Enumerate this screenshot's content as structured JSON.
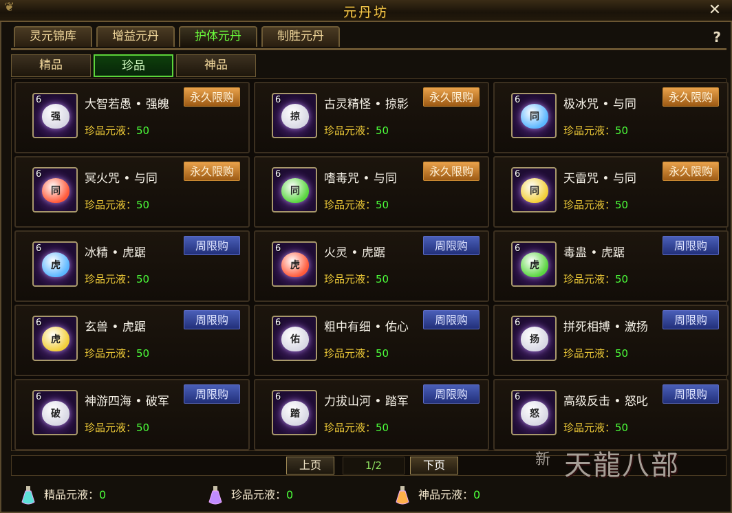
{
  "window": {
    "title": "元丹坊",
    "close": "✕",
    "help": "?"
  },
  "tabs": [
    "灵元锦库",
    "增益元丹",
    "护体元丹",
    "制胜元丹"
  ],
  "active_tab": 2,
  "subtabs": [
    "精品",
    "珍品",
    "神品"
  ],
  "active_subtab": 1,
  "price_label": "珍品元液：",
  "items": [
    {
      "name": "大智若愚 • 强魄",
      "level": "6",
      "glyph": "强",
      "badge": "永久限购",
      "badge_type": "perm",
      "price": "50",
      "color": "#d8d8e4"
    },
    {
      "name": "古灵精怪 • 掠影",
      "level": "6",
      "glyph": "掠",
      "badge": "永久限购",
      "badge_type": "perm",
      "price": "50",
      "color": "#d8d8e4"
    },
    {
      "name": "极冰咒 • 与同",
      "level": "6",
      "glyph": "同",
      "badge": "永久限购",
      "badge_type": "perm",
      "price": "50",
      "color": "#5ab6ff"
    },
    {
      "name": "冥火咒 • 与同",
      "level": "6",
      "glyph": "同",
      "badge": "永久限购",
      "badge_type": "perm",
      "price": "50",
      "color": "#ff5a3a"
    },
    {
      "name": "嗜毒咒 • 与同",
      "level": "6",
      "glyph": "同",
      "badge": "永久限购",
      "badge_type": "perm",
      "price": "50",
      "color": "#5ad640"
    },
    {
      "name": "天雷咒 • 与同",
      "level": "6",
      "glyph": "同",
      "badge": "永久限购",
      "badge_type": "perm",
      "price": "50",
      "color": "#f2cf3a"
    },
    {
      "name": "冰精 • 虎踞",
      "level": "6",
      "glyph": "虎",
      "badge": "周限购",
      "badge_type": "week",
      "price": "50",
      "color": "#5ab6ff"
    },
    {
      "name": "火灵 • 虎踞",
      "level": "6",
      "glyph": "虎",
      "badge": "周限购",
      "badge_type": "week",
      "price": "50",
      "color": "#ff5a3a"
    },
    {
      "name": "毒蛊 • 虎踞",
      "level": "6",
      "glyph": "虎",
      "badge": "周限购",
      "badge_type": "week",
      "price": "50",
      "color": "#5ad640"
    },
    {
      "name": "玄兽 • 虎踞",
      "level": "6",
      "glyph": "虎",
      "badge": "周限购",
      "badge_type": "week",
      "price": "50",
      "color": "#f2cf3a"
    },
    {
      "name": "粗中有细 • 佑心",
      "level": "6",
      "glyph": "佑",
      "badge": "周限购",
      "badge_type": "week",
      "price": "50",
      "color": "#d8d8e4"
    },
    {
      "name": "拼死相搏 • 激扬",
      "level": "6",
      "glyph": "扬",
      "badge": "周限购",
      "badge_type": "week",
      "price": "50",
      "color": "#d8d8e4"
    },
    {
      "name": "神游四海 • 破军",
      "level": "6",
      "glyph": "破",
      "badge": "周限购",
      "badge_type": "week",
      "price": "50",
      "color": "#d8d8e4"
    },
    {
      "name": "力拔山河 • 踏军",
      "level": "6",
      "glyph": "踏",
      "badge": "周限购",
      "badge_type": "week",
      "price": "50",
      "color": "#d8d8e4"
    },
    {
      "name": "高级反击 • 怒叱",
      "level": "6",
      "glyph": "怒",
      "badge": "周限购",
      "badge_type": "week",
      "price": "50",
      "color": "#d8d8e4"
    }
  ],
  "pager": {
    "prev": "上页",
    "page": "1/2",
    "next": "下页"
  },
  "liquids": [
    {
      "label": "精品元液：",
      "value": "0",
      "color": "#5ee0d8"
    },
    {
      "label": "珍品元液：",
      "value": "0",
      "color": "#c08cff"
    },
    {
      "label": "神品元液：",
      "value": "0",
      "color": "#ffb04a"
    }
  ],
  "watermark": {
    "small": "新",
    "main": "天龍八部"
  }
}
